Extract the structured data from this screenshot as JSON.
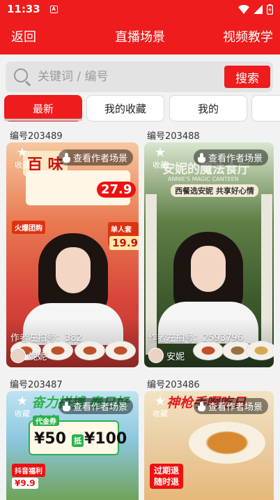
{
  "status": {
    "time": "11:33",
    "notif": "A"
  },
  "appbar": {
    "back": "返回",
    "title": "直播场景",
    "tutorial": "视频教学"
  },
  "search": {
    "placeholder": "关键词 / 编号",
    "button": "搜索"
  },
  "tabs": [
    {
      "label": "最新",
      "active": true
    },
    {
      "label": "我的收藏",
      "active": false
    },
    {
      "label": "我的",
      "active": false
    }
  ],
  "cards": [
    {
      "id": "编号203489",
      "collect": "收藏",
      "view": "查看作者场景",
      "author": "作者左拍号：382",
      "user": "妮妮",
      "banner": "百 味",
      "price1": "27.9",
      "price2": "19.9",
      "tag1": "火爆团购",
      "tag2": "单人套餐"
    },
    {
      "id": "编号203488",
      "collect": "收藏",
      "view": "查看作者场景",
      "author": "作者左拍号：2593796",
      "user": "安妮",
      "banner": "安妮的魔法食厅",
      "sub": "ANNIE'S MAGIC CANTEEN",
      "slogan": "西餐选安妮 共享好心情"
    },
    {
      "id": "编号203487",
      "collect": "收藏",
      "view": "查看作者场景",
      "banner": "奋力拼搏 春日好食光",
      "coupon_label": "代金券",
      "coupon_50": "¥50",
      "coupon_mid": "抵",
      "coupon_100": "¥100",
      "promo": "抖音福利",
      "promo_price": "¥9.9"
    },
    {
      "id": "编号203486",
      "collect": "收藏",
      "view": "查看作者场景",
      "banner": "神枪手啊吃日",
      "badge": "过期退 随时退"
    }
  ],
  "colors": {
    "brand": "#ee1c1c"
  }
}
